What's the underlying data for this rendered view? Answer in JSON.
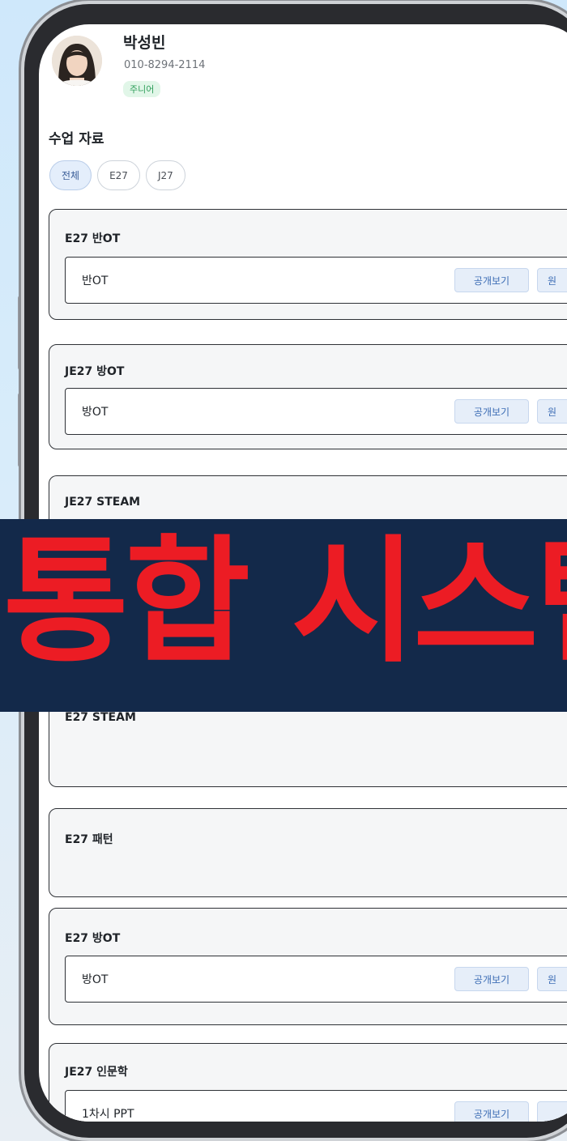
{
  "profile": {
    "name": "박성빈",
    "phone": "010-8294-2114",
    "level": "주니어"
  },
  "section": {
    "title": "수업 자료"
  },
  "filters": [
    {
      "label": "전체",
      "active": true
    },
    {
      "label": "E27",
      "active": false
    },
    {
      "label": "J27",
      "active": false
    }
  ],
  "cards": [
    {
      "title": "E27 반OT",
      "material": "반OT",
      "public_label": "공개보기",
      "original_label": "원"
    },
    {
      "title": "JE27 방OT",
      "material": "방OT",
      "public_label": "공개보기",
      "original_label": "원"
    },
    {
      "title": "JE27 STEAM"
    },
    {
      "title": "E27 STEAM"
    },
    {
      "title": "E27 패턴"
    },
    {
      "title": "E27 방OT",
      "material": "방OT",
      "public_label": "공개보기",
      "original_label": "원"
    },
    {
      "title": "JE27 인문학",
      "material": "1차시 PPT",
      "public_label": "공개보기",
      "original_label": ""
    }
  ],
  "banner": {
    "text": "통합 시스템"
  },
  "colors": {
    "banner_bg": "#13294a",
    "banner_text": "#ec1c24",
    "accent_blue": "#3d6db5",
    "badge_green": "#2f9e5a"
  }
}
